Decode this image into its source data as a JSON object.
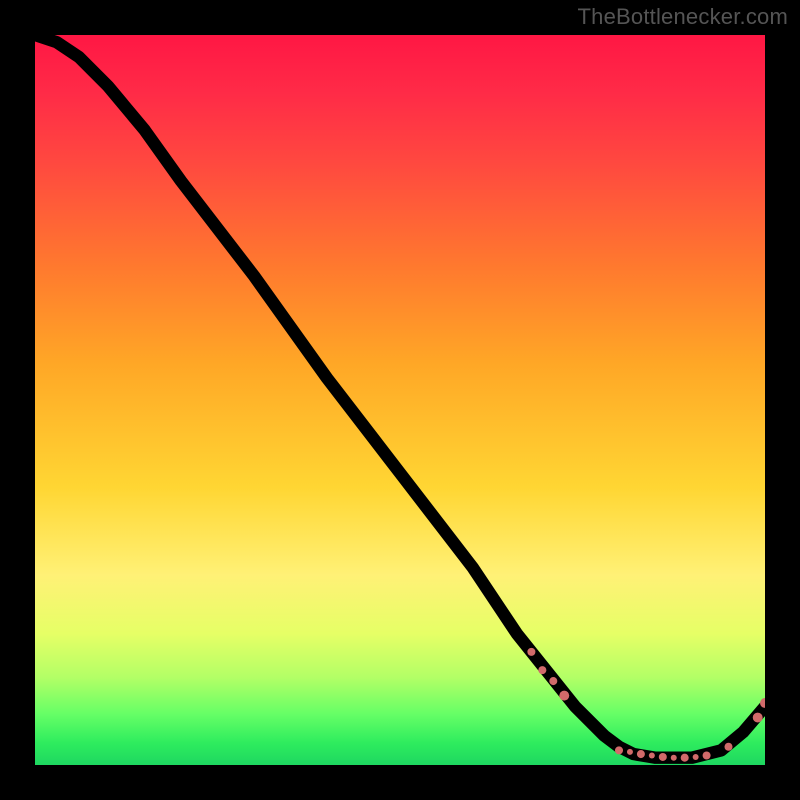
{
  "attribution": "TheBottlenecker.com",
  "chart_data": {
    "type": "line",
    "title": "",
    "xlabel": "",
    "ylabel": "",
    "xlim": [
      0,
      100
    ],
    "ylim": [
      0,
      100
    ],
    "series": [
      {
        "name": "curve",
        "points": [
          {
            "x": 0,
            "y": 100
          },
          {
            "x": 3,
            "y": 99
          },
          {
            "x": 6,
            "y": 97
          },
          {
            "x": 10,
            "y": 93
          },
          {
            "x": 15,
            "y": 87
          },
          {
            "x": 20,
            "y": 80
          },
          {
            "x": 30,
            "y": 67
          },
          {
            "x": 40,
            "y": 53
          },
          {
            "x": 50,
            "y": 40
          },
          {
            "x": 60,
            "y": 27
          },
          {
            "x": 66,
            "y": 18
          },
          {
            "x": 70,
            "y": 13
          },
          {
            "x": 74,
            "y": 8
          },
          {
            "x": 78,
            "y": 4
          },
          {
            "x": 80,
            "y": 2.5
          },
          {
            "x": 82,
            "y": 1.5
          },
          {
            "x": 85,
            "y": 1
          },
          {
            "x": 90,
            "y": 1
          },
          {
            "x": 94,
            "y": 2
          },
          {
            "x": 97,
            "y": 4.5
          },
          {
            "x": 100,
            "y": 8
          }
        ]
      }
    ],
    "markers": [
      {
        "x": 68.0,
        "y": 15.5,
        "r": 4
      },
      {
        "x": 69.5,
        "y": 13.0,
        "r": 4
      },
      {
        "x": 71.0,
        "y": 11.5,
        "r": 4
      },
      {
        "x": 72.5,
        "y": 9.5,
        "r": 5
      },
      {
        "x": 80.0,
        "y": 2.0,
        "r": 4
      },
      {
        "x": 81.5,
        "y": 1.8,
        "r": 3
      },
      {
        "x": 83.0,
        "y": 1.5,
        "r": 4
      },
      {
        "x": 84.5,
        "y": 1.3,
        "r": 3
      },
      {
        "x": 86.0,
        "y": 1.1,
        "r": 4
      },
      {
        "x": 87.5,
        "y": 1.0,
        "r": 3
      },
      {
        "x": 89.0,
        "y": 1.0,
        "r": 4
      },
      {
        "x": 90.5,
        "y": 1.1,
        "r": 3
      },
      {
        "x": 92.0,
        "y": 1.3,
        "r": 4
      },
      {
        "x": 95.0,
        "y": 2.5,
        "r": 4
      },
      {
        "x": 99.0,
        "y": 6.5,
        "r": 5
      },
      {
        "x": 100.0,
        "y": 8.5,
        "r": 5
      }
    ]
  }
}
